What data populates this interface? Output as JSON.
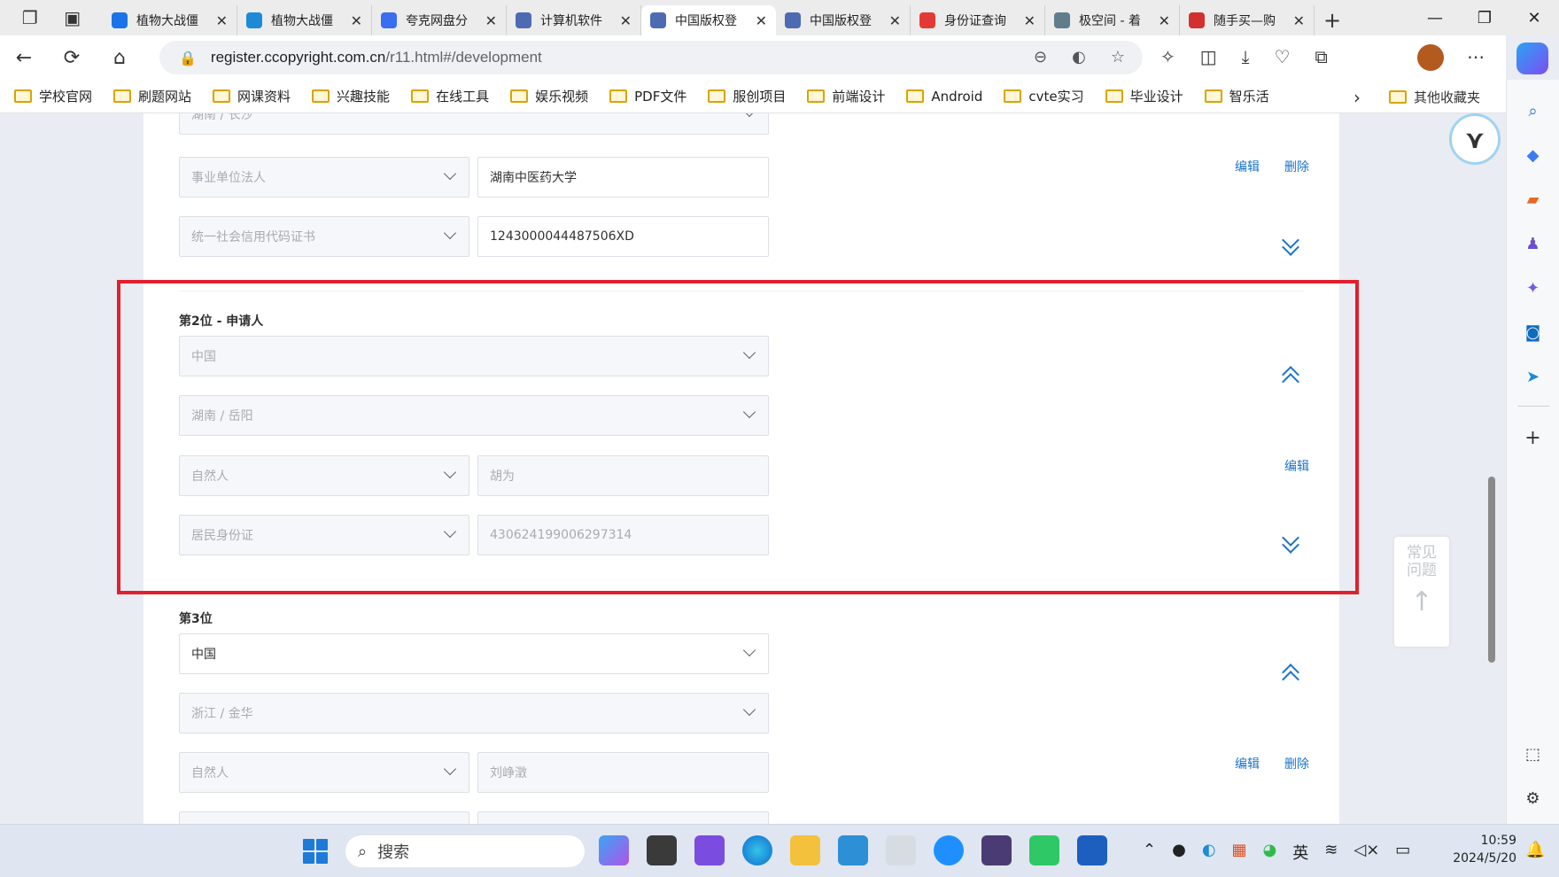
{
  "browser": {
    "tabs": [
      {
        "title": "植物大战僵",
        "color": "#1a73e8",
        "icon": "search-icon"
      },
      {
        "title": "植物大战僵",
        "color": "#1c8ad6",
        "icon": "tv-icon"
      },
      {
        "title": "夸克网盘分",
        "color": "#3b6df0",
        "icon": "cloud-icon"
      },
      {
        "title": "计算机软件",
        "color": "#4d6bb3",
        "icon": "globe-icon"
      },
      {
        "title": "中国版权登",
        "color": "#4d6bb3",
        "icon": "globe-icon",
        "active": true
      },
      {
        "title": "中国版权登",
        "color": "#4d6bb3",
        "icon": "globe-icon"
      },
      {
        "title": "身份证查询",
        "color": "#e53935",
        "icon": "flag-icon"
      },
      {
        "title": "极空间 - 着",
        "color": "#607d8b",
        "icon": "storage-icon"
      },
      {
        "title": "随手买—购",
        "color": "#d32f2f",
        "icon": "pdf-icon"
      }
    ],
    "url_host": "register.ccopyright.com.cn",
    "url_path": "/r11.html#/development",
    "bookmarks": [
      "学校官网",
      "刷题网站",
      "网课资料",
      "兴趣技能",
      "在线工具",
      "娱乐视频",
      "PDF文件",
      "服创项目",
      "前端设计",
      "Android",
      "cvte实习",
      "毕业设计",
      "智乐活"
    ],
    "other_bookmarks": "其他收藏夹"
  },
  "form": {
    "top": {
      "region": "湖南 / 长沙",
      "applicant_type": "事业单位法人",
      "name": "湖南中医药大学",
      "id_type": "统一社会信用代码证书",
      "id_number": "1243000044487506XD",
      "edit": "编辑",
      "delete": "删除"
    },
    "applicant2": {
      "title": "第2位 - 申请人",
      "country": "中国",
      "region": "湖南 / 岳阳",
      "applicant_type": "自然人",
      "name": "胡为",
      "id_type": "居民身份证",
      "id_number": "430624199006297314",
      "edit": "编辑"
    },
    "applicant3": {
      "title": "第3位",
      "country": "中国",
      "region": "浙江 / 金华",
      "applicant_type": "自然人",
      "name": "刘峥澂",
      "edit": "编辑",
      "delete": "删除"
    },
    "faq": "常见问题"
  },
  "taskbar": {
    "search": "搜索",
    "ime": "英",
    "time": "10:59",
    "date": "2024/5/20"
  },
  "colors": {
    "accent": "#1a73c9",
    "highlight_box": "#e0202e"
  }
}
